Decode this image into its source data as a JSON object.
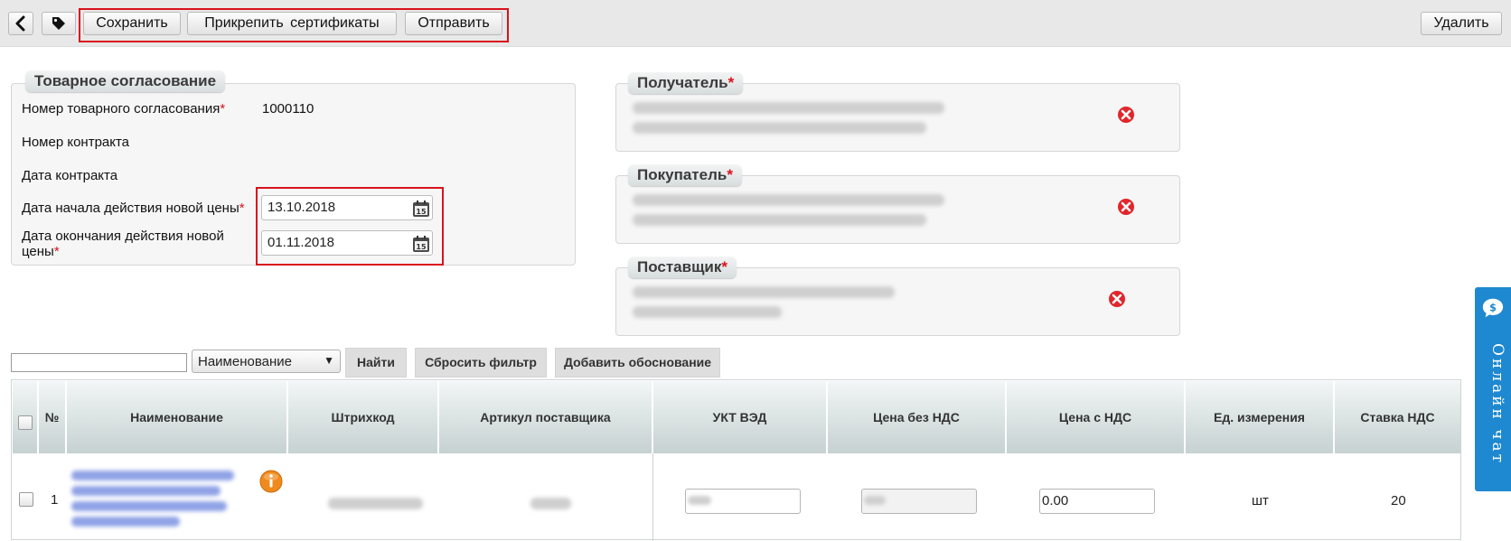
{
  "toolbar": {
    "back_icon": "chevron-left-icon",
    "tag_icon": "tag-icon",
    "save_label": "Сохранить",
    "attach_label": "Прикрепить сертификаты",
    "send_label": "Отправить",
    "delete_label": "Удалить"
  },
  "agreement": {
    "title": "Товарное согласование",
    "number_label": "Номер товарного согласования",
    "number_value": "1000110",
    "contract_number_label": "Номер контракта",
    "contract_date_label": "Дата контракта",
    "price_start_label": "Дата начала действия новой цены",
    "price_start_value": "13.10.2018",
    "price_end_label": "Дата окончания действия новой цены",
    "price_end_value": "01.11.2018",
    "required_mark": "*"
  },
  "parties": {
    "recipient_title": "Получатель",
    "buyer_title": "Покупатель",
    "supplier_title": "Поставщик",
    "remove_icon": "close-circle-icon"
  },
  "filter": {
    "search_value": "",
    "field_selected": "Наименование",
    "find_label": "Найти",
    "reset_label": "Сбросить фильтр",
    "add_reason_label": "Добавить обоснование"
  },
  "table": {
    "columns": [
      "№",
      "Наименование",
      "Штрихкод",
      "Артикул поставщика",
      "УКТ ВЭД",
      "Цена без НДС",
      "Цена с НДС",
      "Ед. измерения",
      "Ставка НДС"
    ],
    "rows": [
      {
        "num": "1",
        "price_vat": "0.00",
        "unit": "шт",
        "vat_rate": "20",
        "info_icon": "info-icon"
      }
    ]
  },
  "chat": {
    "label": "Онлайн чат",
    "icon": "chat-bubble-icon"
  },
  "colors": {
    "highlight": "#d8121d",
    "required": "#d8121d",
    "chat": "#1e88d0",
    "remove": "#e0262c",
    "info": "#f08a1c"
  }
}
